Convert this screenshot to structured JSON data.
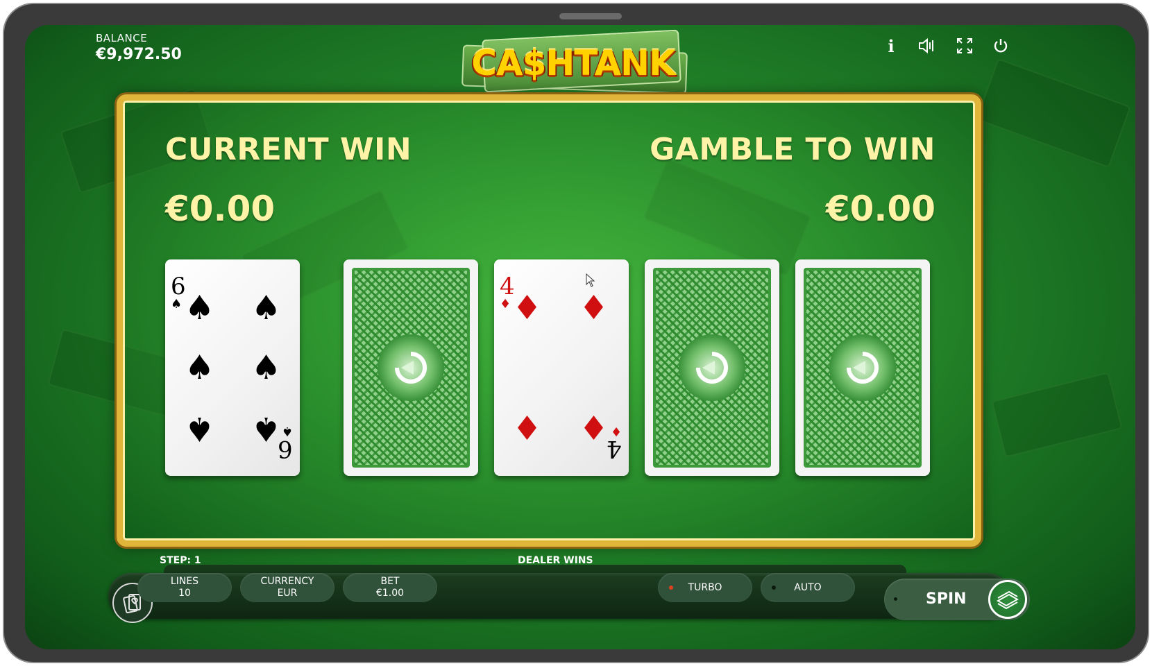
{
  "header": {
    "balance_label": "BALANCE",
    "balance_value": "€9,972.50",
    "logo_text": "CA$HTANK"
  },
  "top_icons": [
    "info-icon",
    "sound-icon",
    "fullscreen-icon",
    "power-icon"
  ],
  "top_icon_glyphs": {
    "info": "i"
  },
  "gamble": {
    "current_win_label": "CURRENT WIN",
    "current_win_value": "€0.00",
    "gamble_to_win_label": "GAMBLE TO WIN",
    "gamble_to_win_value": "€0.00"
  },
  "cards": [
    {
      "state": "face-up",
      "rank": "6",
      "suit": "♠",
      "color": "#000000"
    },
    {
      "state": "face-down"
    },
    {
      "state": "face-up",
      "rank": "4",
      "suit": "♦",
      "color": "#d01010"
    },
    {
      "state": "face-down"
    },
    {
      "state": "face-down"
    }
  ],
  "bottom_bar": {
    "step_label": "STEP: 1",
    "status_text": "DEALER WINS",
    "lines_label": "LINES",
    "lines_value": "10",
    "currency_label": "CURRENCY",
    "currency_value": "EUR",
    "bet_label": "BET",
    "bet_value": "€1.00",
    "turbo_label": "TURBO",
    "auto_label": "AUTO",
    "spin_label": "SPIN"
  },
  "colors": {
    "frame_gold": "#e0b53a",
    "heading_yellow": "#fff3a8",
    "felt_green": "#23862a",
    "diamond_red": "#d01010",
    "turbo_dot": "#e04020"
  }
}
